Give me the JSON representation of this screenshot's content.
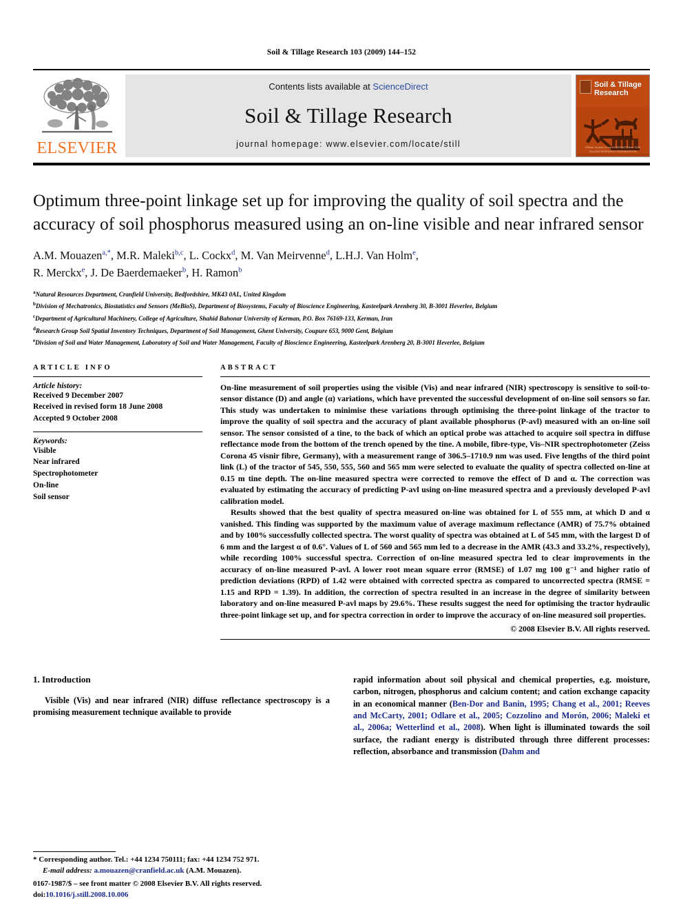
{
  "running_head": "Soil & Tillage Research 103 (2009) 144–152",
  "masthead": {
    "contents_prefix": "Contents lists available at ",
    "sciencedirect": "ScienceDirect",
    "journal_title": "Soil & Tillage Research",
    "homepage": "journal homepage: www.elsevier.com/locate/still",
    "publisher_wordmark": "ELSEVIER",
    "cover_title": "Soil & Tillage Research",
    "cover_footer": "Official Journal of the\nINTERNATIONAL SOIL TILLAGE RESEARCH ORGANIZATION",
    "accent_color": "#F37021",
    "link_color": "#2b4ba0",
    "cover_color": "#C04A12"
  },
  "article": {
    "title": "Optimum three-point linkage set up for improving the quality of soil spectra and the accuracy of soil phosphorus measured using an on-line visible and near infrared sensor",
    "authors_line1": "A.M. Mouazen",
    "authors": [
      {
        "name": "A.M. Mouazen",
        "marks": "a,*"
      },
      {
        "name": "M.R. Maleki",
        "marks": "b,c"
      },
      {
        "name": "L. Cockx",
        "marks": "d"
      },
      {
        "name": "M. Van Meirvenne",
        "marks": "d"
      },
      {
        "name": "L.H.J. Van Holm",
        "marks": "e"
      },
      {
        "name": "R. Merckx",
        "marks": "e"
      },
      {
        "name": "J. De Baerdemaeker",
        "marks": "b"
      },
      {
        "name": "H. Ramon",
        "marks": "b"
      }
    ],
    "affiliations": [
      {
        "mark": "a",
        "text": "Natural Resources Department, Cranfield University, Bedfordshire, MK43 0AL, United Kingdom"
      },
      {
        "mark": "b",
        "text": "Division of Mechatronics, Biostatistics and Sensors (MeBioS), Department of Biosystems, Faculty of Bioscience Engineering, Kasteelpark Arenberg 30, B-3001 Heverlee, Belgium"
      },
      {
        "mark": "c",
        "text": "Department of Agricultural Machinery, College of Agriculture, Shahid Bahonar University of Kerman, P.O. Box 76169-133, Kerman, Iran"
      },
      {
        "mark": "d",
        "text": "Research Group Soil Spatial Inventory Techniques, Department of Soil Management, Ghent University, Coupure 653, 9000 Gent, Belgium"
      },
      {
        "mark": "e",
        "text": "Division of Soil and Water Management, Laboratory of Soil and Water Management, Faculty of Bioscience Engineering, Kasteelpark Arenberg 20, B-3001 Heverlee, Belgium"
      }
    ]
  },
  "article_info": {
    "heading": "ARTICLE INFO",
    "history_label": "Article history:",
    "history": [
      "Received 9 December 2007",
      "Received in revised form 18 June 2008",
      "Accepted 9 October 2008"
    ],
    "keywords_label": "Keywords:",
    "keywords": [
      "Visible",
      "Near infrared",
      "Spectrophotometer",
      "On-line",
      "Soil sensor"
    ]
  },
  "abstract": {
    "heading": "ABSTRACT",
    "paragraph1": "On-line measurement of soil properties using the visible (Vis) and near infrared (NIR) spectroscopy is sensitive to soil-to-sensor distance (D) and angle (α) variations, which have prevented the successful development of on-line soil sensors so far. This study was undertaken to minimise these variations through optimising the three-point linkage of the tractor to improve the quality of soil spectra and the accuracy of plant available phosphorus (P-avl) measured with an on-line soil sensor. The sensor consisted of a tine, to the back of which an optical probe was attached to acquire soil spectra in diffuse reflectance mode from the bottom of the trench opened by the tine. A mobile, fibre-type, Vis–NIR spectrophotometer (Zeiss Corona 45 visnir fibre, Germany), with a measurement range of 306.5–1710.9 nm was used. Five lengths of the third point link (L) of the tractor of 545, 550, 555, 560 and 565 mm were selected to evaluate the quality of spectra collected on-line at 0.15 m tine depth. The on-line measured spectra were corrected to remove the effect of D and α. The correction was evaluated by estimating the accuracy of predicting P-avl using on-line measured spectra and a previously developed P-avl calibration model.",
    "paragraph2": "Results showed that the best quality of spectra measured on-line was obtained for L of 555 mm, at which D and α vanished. This finding was supported by the maximum value of average maximum reflectance (AMR) of 75.7% obtained and by 100% successfully collected spectra. The worst quality of spectra was obtained at L of 545 mm, with the largest D of 6 mm and the largest α of 0.6°. Values of L of 560 and 565 mm led to a decrease in the AMR (43.3 and 33.2%, respectively), while recording 100% successful spectra. Correction of on-line measured spectra led to clear improvements in the accuracy of on-line measured P-avl. A lower root mean square error (RMSE) of 1.07 mg 100 g⁻¹ and higher ratio of prediction deviations (RPD) of 1.42 were obtained with corrected spectra as compared to uncorrected spectra (RMSE = 1.15 and RPD = 1.39). In addition, the correction of spectra resulted in an increase in the degree of similarity between laboratory and on-line measured P-avl maps by 29.6%. These results suggest the need for optimising the tractor hydraulic three-point linkage set up, and for spectra correction in order to improve the accuracy of on-line measured soil properties.",
    "copyright": "© 2008 Elsevier B.V. All rights reserved."
  },
  "introduction": {
    "heading": "1. Introduction",
    "left_text": "Visible (Vis) and near infrared (NIR) diffuse reflectance spectroscopy is a promising measurement technique available to provide",
    "right_parts": [
      {
        "type": "text",
        "value": "rapid information about soil physical and chemical properties, e.g. moisture, carbon, nitrogen, phosphorus and calcium content; and cation exchange capacity in an economical manner ("
      },
      {
        "type": "ref",
        "value": "Ben-Dor and Banin, 1995; Chang et al., 2001; Reeves and McCarty, 2001; Odlare et al., 2005; Cozzolino and Morón, 2006; Maleki et al., 2006a; Wetterlind et al., 2008"
      },
      {
        "type": "text",
        "value": "). When light is illuminated towards the soil surface, the radiant energy is distributed through three different processes: reflection, absorbance and transmission ("
      },
      {
        "type": "ref",
        "value": "Dahm and"
      }
    ]
  },
  "footnotes": {
    "corresponding": "* Corresponding author. Tel.: +44 1234 750111; fax: +44 1234 752 971.",
    "email_label": "E-mail address:",
    "email": "a.mouazen@cranfield.ac.uk",
    "email_suffix": "(A.M. Mouazen)."
  },
  "imprint": {
    "line1": "0167-1987/$ – see front matter © 2008 Elsevier B.V. All rights reserved.",
    "doi_label": "doi:",
    "doi": "10.1016/j.still.2008.10.006"
  }
}
